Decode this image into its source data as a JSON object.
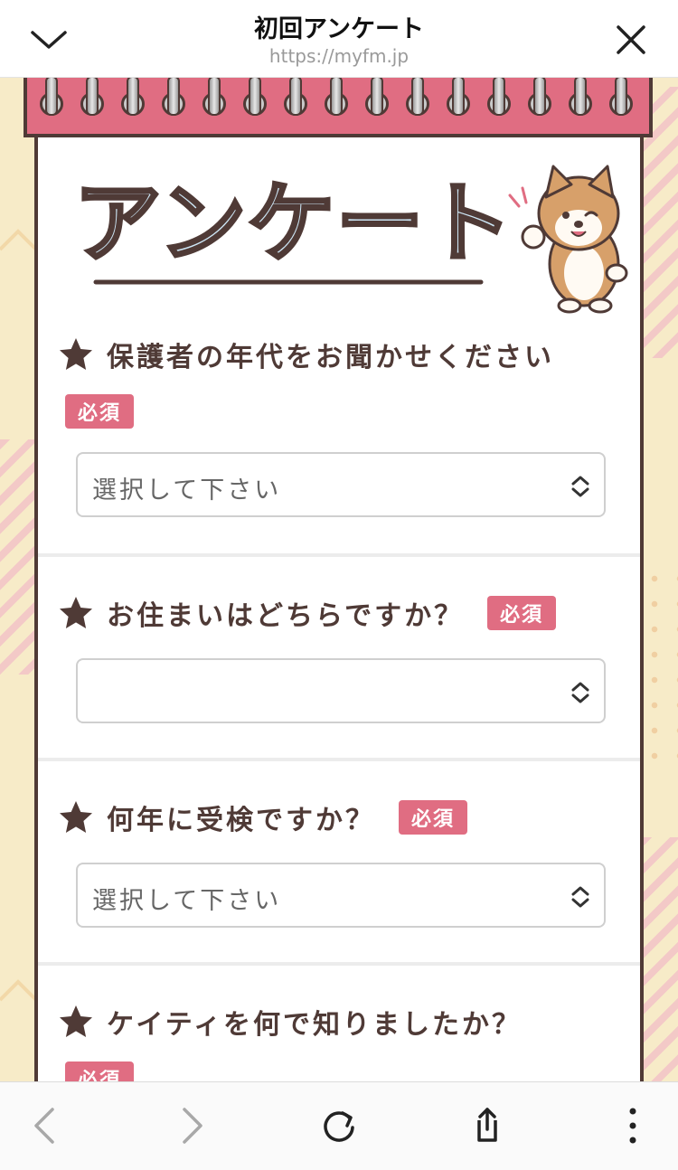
{
  "browser": {
    "title": "初回アンケート",
    "url": "https://myfm.jp"
  },
  "hero": {
    "heading": "アンケート"
  },
  "required_label": "必須",
  "questions": [
    {
      "label": "保護者の年代をお聞かせください",
      "select_value": "選択して下さい"
    },
    {
      "label": "お住まいはどちらですか？",
      "select_value": ""
    },
    {
      "label": "何年に受検ですか？",
      "select_value": "選択して下さい"
    },
    {
      "label": "ケイティを何で知りましたか？"
    }
  ],
  "colors": {
    "accent": "#e06d82",
    "text": "#4f3a36",
    "background": "#f7ebc8"
  },
  "icons": {
    "nav_down": "chevron-down-icon",
    "close": "close-icon",
    "back": "back-arrow-icon",
    "forward": "forward-arrow-icon",
    "reload": "reload-icon",
    "share": "share-icon",
    "more": "more-vertical-icon"
  }
}
